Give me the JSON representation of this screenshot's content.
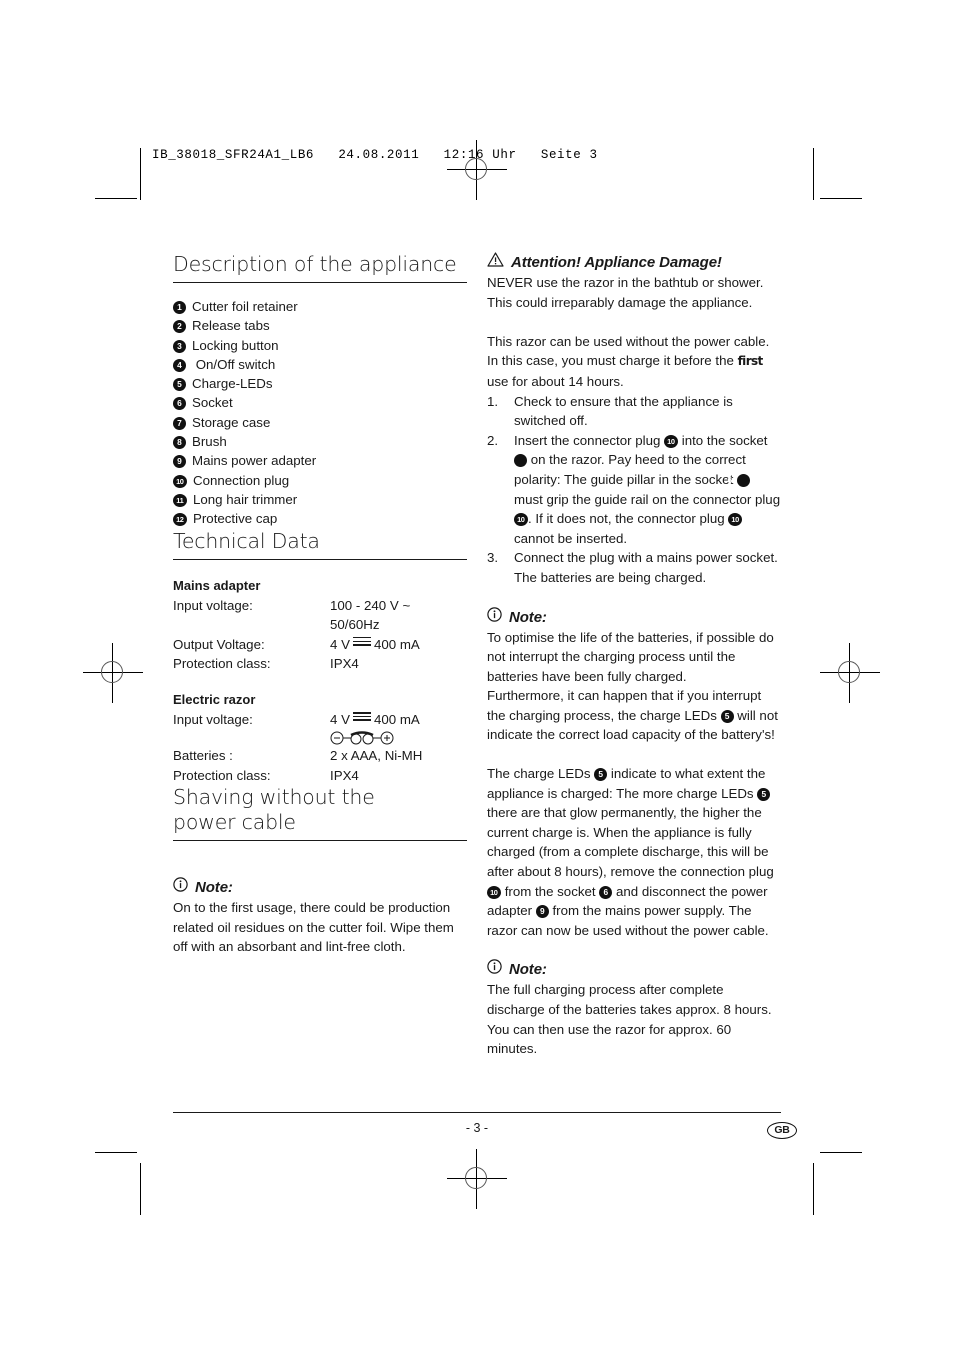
{
  "proof_header": "IB_38018_SFR24A1_LB6   24.08.2011   12:16 Uhr   Seite 3",
  "left_column": {
    "description": {
      "heading": "Description of the appliance",
      "items": [
        {
          "num": "1",
          "label": "Cutter foil retainer"
        },
        {
          "num": "2",
          "label": "Release tabs"
        },
        {
          "num": "3",
          "label": "Locking button"
        },
        {
          "num": "4",
          "label": " On/Off switch"
        },
        {
          "num": "5",
          "label": "Charge-LEDs"
        },
        {
          "num": "6",
          "label": "Socket"
        },
        {
          "num": "7",
          "label": "Storage case"
        },
        {
          "num": "8",
          "label": "Brush"
        },
        {
          "num": "9",
          "label": "Mains power adapter"
        },
        {
          "num": "10",
          "label": "Connection plug"
        },
        {
          "num": "11",
          "label": "Long hair trimmer"
        },
        {
          "num": "12",
          "label": "Protective cap"
        }
      ]
    },
    "technical": {
      "heading": "Technical Data",
      "mains_adapter": {
        "subhead": "Mains adapter",
        "rows": [
          {
            "key": "Input voltage:",
            "value_line1": "100 - 240 V ~",
            "value_line2": "50/60Hz"
          },
          {
            "key": "Output Voltage:",
            "value_pre": "4 V",
            "value_post": "400 mA"
          },
          {
            "key": "Protection class:",
            "value_line1": "IPX4"
          }
        ]
      },
      "electric_razor": {
        "subhead": "Electric razor",
        "rows": [
          {
            "key": "Input voltage:",
            "value_pre": "4 V",
            "value_post": "400 mA"
          },
          {
            "key": "Batteries :",
            "value_line1": "2 x AAA, Ni-MH"
          },
          {
            "key": "Protection class:",
            "value_line1": "IPX4"
          }
        ]
      }
    },
    "shaving": {
      "heading_line1": "Shaving without the",
      "heading_line2": "power cable",
      "note_label": "Note:",
      "note_body": "On to the first usage, there could be production related oil residues on the cutter foil. Wipe them off with an absorbant and lint-free cloth."
    }
  },
  "right_column": {
    "attention": {
      "label": "Attention! Appliance Damage!",
      "body": "NEVER use the razor in the bathtub or shower. This could irreparably damage the appliance."
    },
    "intro_p1": "This razor can be used without the power cable. In this case, you must charge it before the ",
    "intro_first": "first",
    "intro_p1b": " use for about 14 hours.",
    "steps": [
      {
        "n": "1.",
        "text": "Check to ensure that the appliance is switched off."
      },
      {
        "n": "2.",
        "text_parts": [
          "Insert the connector plug ",
          "10",
          " into the socket ",
          "6",
          " on the razor. Pay heed to the correct polarity: The guide pillar in the socket ",
          "6",
          " must grip the guide rail on the connector plug ",
          "10",
          ". If it does not, the connector plug ",
          "10",
          " cannot be inserted."
        ]
      },
      {
        "n": "3.",
        "text": "Connect the plug with a mains power socket. The batteries are being charged."
      }
    ],
    "note1": {
      "label": "Note:",
      "para1": "To optimise the life of the batteries, if possible do not interrupt the charging process until the batteries have been fully charged.",
      "para2_parts": [
        "Furthermore, it can happen that if you interrupt the charging process, the charge LEDs ",
        "5",
        " will not indicate the correct load capacity of the battery's!"
      ]
    },
    "charge_paragraph_parts": [
      "The charge LEDs ",
      "5",
      " indicate to what extent the appliance is charged: The more charge LEDs ",
      "5",
      " there are that glow permanently, the higher the current charge is. When the appliance is fully charged (from a complete discharge, this will be after about 8 hours), remove the connection plug ",
      "10",
      " from the socket ",
      "6",
      " and disconnect the power adapter ",
      "9",
      " from the mains power supply. The razor can now be used without the power cable."
    ],
    "note2": {
      "label": "Note:",
      "body": "The full charging process after complete discharge of the batteries takes approx. 8 hours. You can then use the razor for approx. 60 minutes."
    }
  },
  "footer": {
    "page_number": "- 3 -",
    "language": "GB"
  },
  "icons": {
    "warning": "warning-triangle-icon",
    "info": "info-circle-icon"
  },
  "colors": {
    "text": "#1a1a1a",
    "rule": "#1a1a1a",
    "badge_fill": "#111111"
  }
}
